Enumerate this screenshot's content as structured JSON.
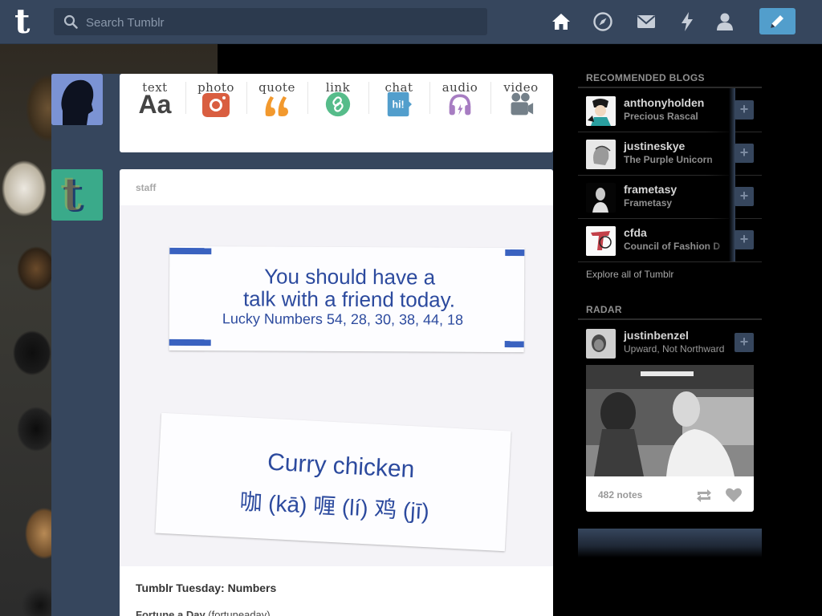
{
  "header": {
    "search": {
      "placeholder": "Search Tumblr"
    },
    "nav": [
      {
        "icon": "home-icon",
        "label": "Dashboard"
      },
      {
        "icon": "compass-icon",
        "label": "Explore"
      },
      {
        "icon": "mail-icon",
        "label": "Inbox"
      },
      {
        "icon": "lightning-icon",
        "label": "Activity"
      },
      {
        "icon": "person-icon",
        "label": "Account"
      }
    ],
    "compose_icon": "pencil-icon"
  },
  "post_types": [
    {
      "label": "text",
      "icon": "text-aa-icon",
      "color": "#444444"
    },
    {
      "label": "photo",
      "icon": "camera-icon",
      "color": "#d95e40"
    },
    {
      "label": "quote",
      "icon": "quote-icon",
      "color": "#f2992e"
    },
    {
      "label": "link",
      "icon": "link-icon",
      "color": "#56bc8a"
    },
    {
      "label": "chat",
      "icon": "chat-icon",
      "color": "#529ecc"
    },
    {
      "label": "audio",
      "icon": "headphones-icon",
      "color": "#a77dc2"
    },
    {
      "label": "video",
      "icon": "video-camera-icon",
      "color": "#748089"
    }
  ],
  "post": {
    "author": "staff",
    "image_text": {
      "line1": "You should have a",
      "line2": "talk with a friend today.",
      "line3": "Lucky Numbers  54, 28, 30, 38, 44, 18",
      "line4": "Curry chicken",
      "line5": "咖 (kā) 喱 (lí) 鸡 (jī)"
    },
    "title": "Tumblr Tuesday: Numbers",
    "subtitle_bold": "Fortune a Day",
    "subtitle_rest": " (fortuneaday)"
  },
  "sidebar": {
    "recommended_heading": "RECOMMENDED BLOGS",
    "blogs": [
      {
        "name": "anthonyholden",
        "title": "Precious Rascal"
      },
      {
        "name": "justineskye",
        "title": "The Purple Unicorn"
      },
      {
        "name": "frametasy",
        "title": "Frametasy"
      },
      {
        "name": "cfda",
        "title": "Council of Fashion D"
      }
    ],
    "follow_label": "+",
    "explore_link": "Explore all of Tumblr",
    "radar_heading": "RADAR",
    "radar": {
      "name": "justinbenzel",
      "title": "Upward, Not Northward",
      "notes": "482 notes"
    }
  },
  "colors": {
    "navy": "#36465d",
    "compose_blue": "#529ecc"
  }
}
